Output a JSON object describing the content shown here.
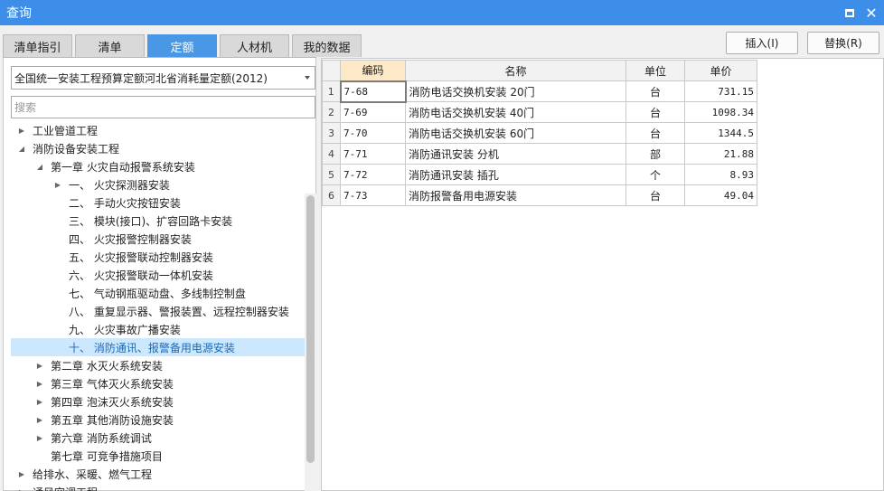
{
  "window": {
    "title": "查询"
  },
  "tabs": [
    {
      "label": "清单指引",
      "active": false
    },
    {
      "label": "清单",
      "active": false
    },
    {
      "label": "定额",
      "active": true
    },
    {
      "label": "人材机",
      "active": false
    },
    {
      "label": "我的数据",
      "active": false
    }
  ],
  "buttons": {
    "insert": "插入(I)",
    "replace": "替换(R)"
  },
  "quota_select": {
    "value": "全国统一安装工程预算定额河北省消耗量定额(2012)"
  },
  "search": {
    "placeholder": "搜索"
  },
  "tree": [
    {
      "label": "工业管道工程",
      "expand": "collapsed"
    },
    {
      "label": "消防设备安装工程",
      "expand": "expanded"
    },
    {
      "label": "第一章 火灾自动报警系统安装",
      "expand": "expanded"
    },
    {
      "label": "一、 火灾探测器安装",
      "expand": "collapsed"
    },
    {
      "label": "二、 手动火灾按钮安装",
      "expand": "none"
    },
    {
      "label": "三、 模块(接口)、扩容回路卡安装",
      "expand": "none"
    },
    {
      "label": "四、 火灾报警控制器安装",
      "expand": "none"
    },
    {
      "label": "五、 火灾报警联动控制器安装",
      "expand": "none"
    },
    {
      "label": "六、 火灾报警联动一体机安装",
      "expand": "none"
    },
    {
      "label": "七、 气动钢瓶驱动盘、多线制控制盘",
      "expand": "none"
    },
    {
      "label": "八、 重复显示器、警报装置、远程控制器安装",
      "expand": "none"
    },
    {
      "label": "九、 火灾事故广播安装",
      "expand": "none"
    },
    {
      "label": "十、 消防通讯、报警备用电源安装",
      "expand": "none",
      "selected": true
    },
    {
      "label": "第二章 水灭火系统安装",
      "expand": "collapsed"
    },
    {
      "label": "第三章 气体灭火系统安装",
      "expand": "collapsed"
    },
    {
      "label": "第四章 泡沫灭火系统安装",
      "expand": "collapsed"
    },
    {
      "label": "第五章 其他消防设施安装",
      "expand": "collapsed"
    },
    {
      "label": "第六章 消防系统调试",
      "expand": "collapsed"
    },
    {
      "label": "第七章 可竞争措施项目",
      "expand": "none"
    },
    {
      "label": "给排水、采暖、燃气工程",
      "expand": "collapsed"
    },
    {
      "label": "通风空调工程",
      "expand": "collapsed"
    }
  ],
  "table": {
    "columns": [
      "编码",
      "名称",
      "单位",
      "单价"
    ],
    "rows": [
      {
        "no": "1",
        "code": "7-68",
        "name": "消防电话交换机安装 20门",
        "unit": "台",
        "price": "731.15"
      },
      {
        "no": "2",
        "code": "7-69",
        "name": "消防电话交换机安装 40门",
        "unit": "台",
        "price": "1098.34"
      },
      {
        "no": "3",
        "code": "7-70",
        "name": "消防电话交换机安装 60门",
        "unit": "台",
        "price": "1344.5"
      },
      {
        "no": "4",
        "code": "7-71",
        "name": "消防通讯安装 分机",
        "unit": "部",
        "price": "21.88"
      },
      {
        "no": "5",
        "code": "7-72",
        "name": "消防通讯安装 插孔",
        "unit": "个",
        "price": "8.93"
      },
      {
        "no": "6",
        "code": "7-73",
        "name": "消防报警备用电源安装",
        "unit": "台",
        "price": "49.04"
      }
    ]
  }
}
